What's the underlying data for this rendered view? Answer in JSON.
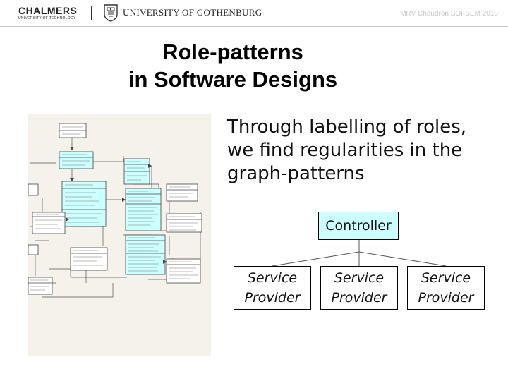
{
  "header": {
    "chalmers_name": "CHALMERS",
    "chalmers_sub": "UNIVERSITY OF TECHNOLOGY",
    "gu_name": "UNIVERSITY OF GOTHENBURG",
    "author": "MRV Chaudron SOFSEM 2018"
  },
  "slide": {
    "title_line1": "Role-patterns",
    "title_line2": "in Software Designs",
    "bullet_lines": [
      "Through labelling of roles,",
      "we find regularities in the",
      "graph-patterns"
    ],
    "role_diagram": {
      "controller_label": "Controller",
      "controller_color": "#ccffff",
      "providers": [
        {
          "line1": "Service",
          "line2": "Provider"
        },
        {
          "line1": "Service",
          "line2": "Provider"
        },
        {
          "line1": "Service",
          "line2": "Provider"
        }
      ]
    },
    "uml_thumbnail": {
      "class_fill": "#ccffff",
      "note_fill": "#ffffff",
      "background": "#f4f2ea"
    }
  }
}
